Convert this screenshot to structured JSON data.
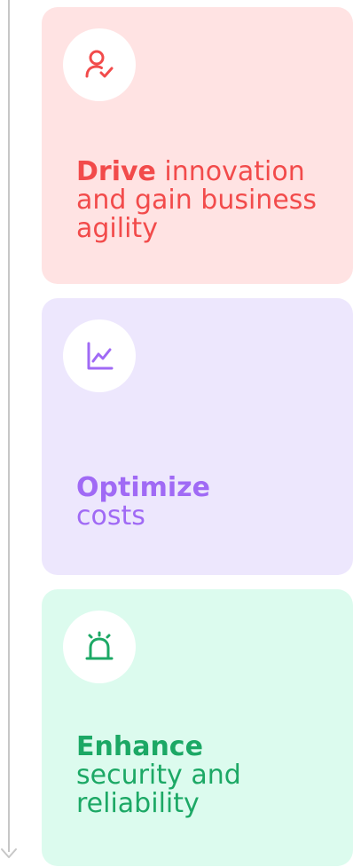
{
  "cards": [
    {
      "icon": "user-check-icon",
      "bold": "Drive",
      "rest": " innovation and gain business agility",
      "accent_color": "#f24b4b",
      "bg_color": "#ffe3e3"
    },
    {
      "icon": "trend-chart-icon",
      "bold": "Optimize",
      "rest": " costs",
      "accent_color": "#a06af5",
      "bg_color": "#ede7fd"
    },
    {
      "icon": "alarm-siren-icon",
      "bold": "Enhance",
      "rest": " security and reliability",
      "accent_color": "#1ca865",
      "bg_color": "#dcfbee"
    }
  ],
  "timeline": {
    "line_color": "#c7c7c7"
  }
}
